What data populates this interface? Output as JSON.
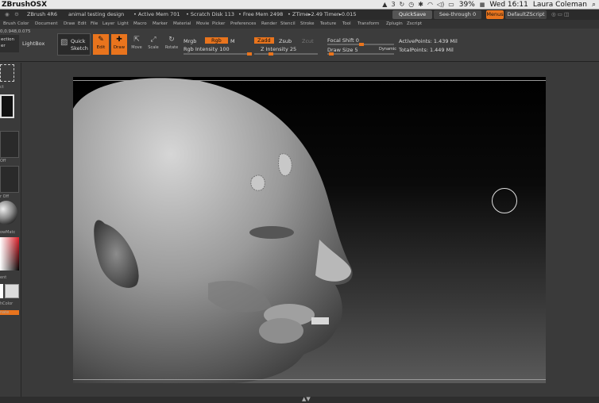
{
  "mac_menubar": {
    "app_name": "ZBrushOSX",
    "battery": "39%",
    "clock": "Wed 16:11",
    "user": "Laura Coleman",
    "tray_badge": "3"
  },
  "zbrush_title": {
    "version": "ZBrush 4R6",
    "document_name": "animal testing design",
    "active_mem": "• Active Mem 701",
    "scratch_disk": "• Scratch Disk 113",
    "free_mem": "• Free Mem 2498",
    "ztime": "• ZTime▸2.49",
    "timer": "Timer▸0.015",
    "quicksave": "QuickSave",
    "see_through": "See-through  0",
    "menus": "Menus",
    "script": "DefaultZScript"
  },
  "menu_items": [
    "Brush",
    "Color",
    "Document",
    "Draw",
    "Edit",
    "File",
    "Layer",
    "Light",
    "Macro",
    "Marker",
    "Material",
    "Movie",
    "Picker",
    "Preferences",
    "Render",
    "Stencil",
    "Stroke",
    "Texture",
    "Tool",
    "Transform",
    "Zplugin",
    "Zscript"
  ],
  "toolbar": {
    "projection": "ection",
    "projection2": "er",
    "coords": "0,0.948,0.075",
    "lightbox": "LightBox",
    "quick_sketch": "Quick",
    "quick_sketch2": "Sketch",
    "edit": "Edit",
    "draw": "Draw",
    "move": "Move",
    "scale": "Scale",
    "rotate": "Rotate",
    "mrgb": "Mrgb",
    "rgb": "Rgb",
    "m": "M",
    "rgb_intensity": "Rgb Intensity 100",
    "zadd": "Zadd",
    "zsub": "Zsub",
    "zcut": "Zcut",
    "z_intensity": "Z Intensity 25",
    "focal_shift": "Focal Shift 0",
    "draw_size": "Draw Size 5",
    "dynamic": "Dynamic",
    "active_points": "ActivePoints: 1.439 Mil",
    "total_points": "TotalPoints: 1.449 Mil"
  },
  "left_shelf": {
    "label1": "ct",
    "label2": "Off",
    "label3": "r Off",
    "label4": "owMatc",
    "label5": "ent",
    "label6": "hColor",
    "label7": "nate"
  },
  "controls": {
    "rgb_intensity_level": 100,
    "z_intensity_level": 25,
    "focal_shift_level": 0,
    "draw_size_level": 5
  },
  "colors": {
    "accent": "#e9741d",
    "ui_bg": "#3c3c3c",
    "menubar": "#e8e8e8"
  }
}
